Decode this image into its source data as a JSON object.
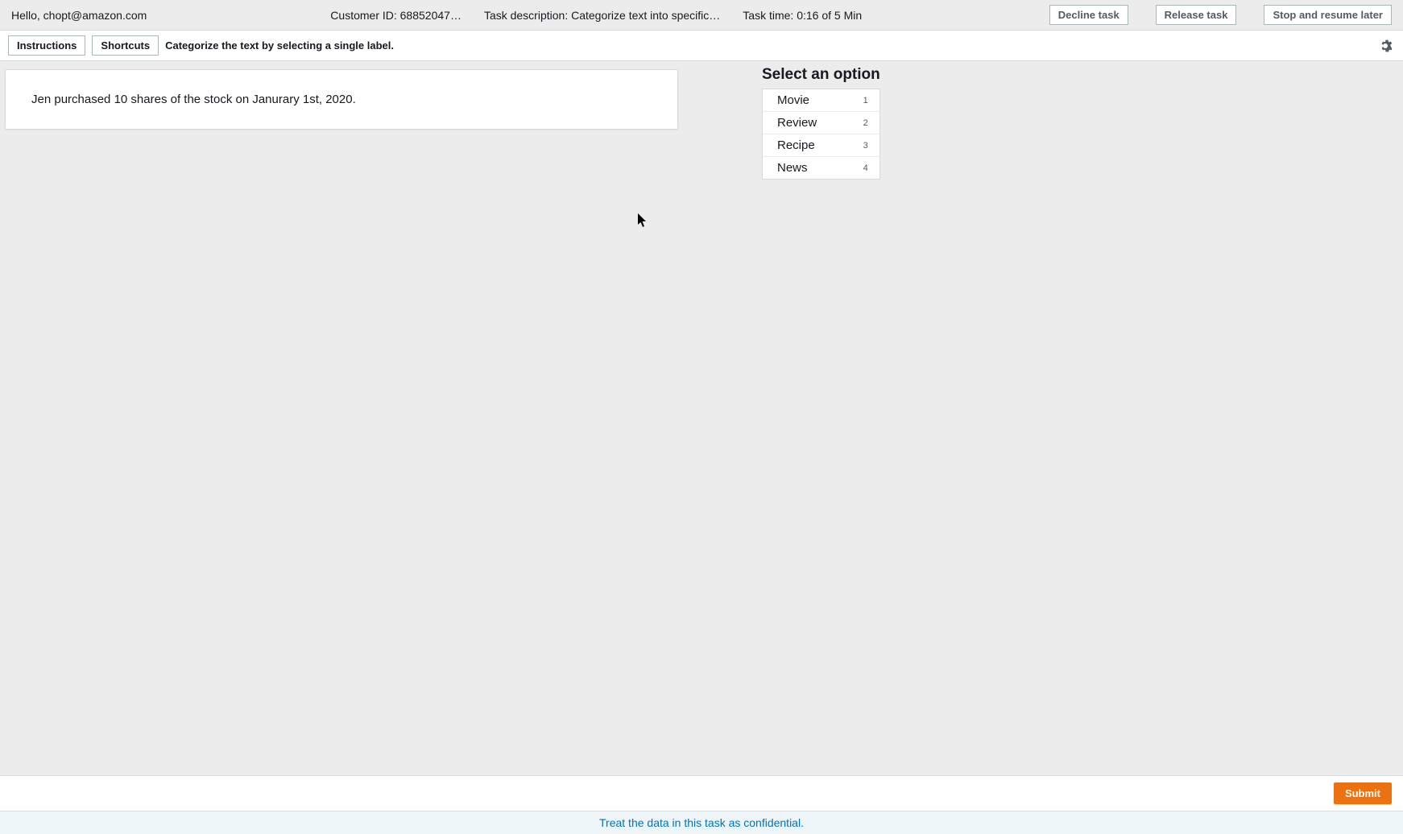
{
  "topbar": {
    "greeting": "Hello, chopt@amazon.com",
    "customer_id": "Customer ID: 68852047…",
    "task_description": "Task description: Categorize text into specific…",
    "task_time": "Task time: 0:16 of 5 Min",
    "decline": "Decline task",
    "release": "Release task",
    "stop_resume": "Stop and resume later"
  },
  "subbar": {
    "instructions": "Instructions",
    "shortcuts": "Shortcuts",
    "hint": "Categorize the text by selecting a single label."
  },
  "task": {
    "text": "Jen purchased 10 shares of the stock on Janurary 1st, 2020."
  },
  "options": {
    "heading": "Select an option",
    "items": [
      {
        "label": "Movie",
        "shortcut": "1"
      },
      {
        "label": "Review",
        "shortcut": "2"
      },
      {
        "label": "Recipe",
        "shortcut": "3"
      },
      {
        "label": "News",
        "shortcut": "4"
      }
    ]
  },
  "footer": {
    "submit": "Submit"
  },
  "confidential": "Treat the data in this task as confidential."
}
